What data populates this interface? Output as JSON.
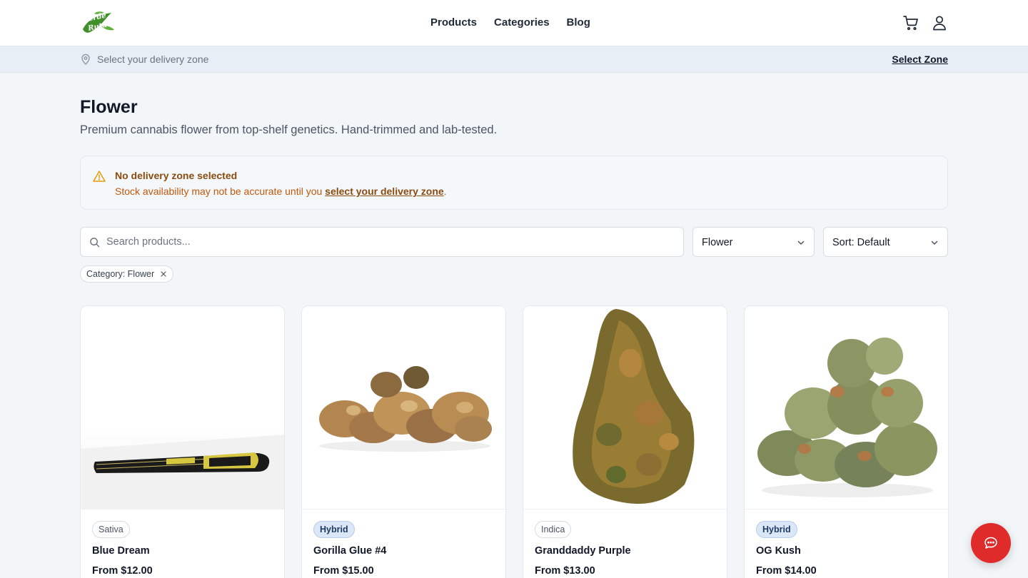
{
  "header": {
    "logo_text": [
      "Verde",
      "Ruta"
    ],
    "nav": [
      "Products",
      "Categories",
      "Blog"
    ],
    "icons": [
      "cart-icon",
      "user-icon"
    ]
  },
  "zone_bar": {
    "prompt": "Select your delivery zone",
    "action": "Select Zone"
  },
  "page": {
    "title": "Flower",
    "subtitle": "Premium cannabis flower from top-shelf genetics. Hand-trimmed and lab-tested."
  },
  "alert": {
    "title": "No delivery zone selected",
    "body_prefix": "Stock availability may not be accurate until you ",
    "link": "select your delivery zone",
    "body_suffix": "."
  },
  "filters": {
    "search_placeholder": "Search products...",
    "category_select": "Flower",
    "sort_select": "Sort: Default",
    "active_chip": "Category: Flower"
  },
  "products": [
    {
      "type": "Sativa",
      "name": "Blue Dream",
      "price": "From $12.00"
    },
    {
      "type": "Hybrid",
      "name": "Gorilla Glue #4",
      "price": "From $15.00"
    },
    {
      "type": "Indica",
      "name": "Granddaddy Purple",
      "price": "From $13.00"
    },
    {
      "type": "Hybrid",
      "name": "OG Kush",
      "price": "From $14.00"
    }
  ],
  "colors": {
    "brand_green": "#3f8f2a",
    "alert_text": "#c2570a",
    "alert_title": "#8a4b0f",
    "chat_button": "#e02b2b",
    "hybrid_badge": "#dbe7f6"
  }
}
